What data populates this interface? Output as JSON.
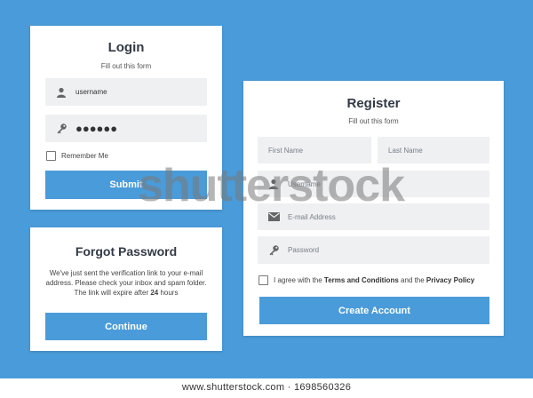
{
  "colors": {
    "background": "#4a9bd9",
    "button": "#4a9bd9",
    "field": "#eef0f2"
  },
  "login": {
    "title": "Login",
    "subtitle": "Fill out this form",
    "username_value": "username",
    "password_value": "●●●●●●",
    "remember_label": "Remember Me",
    "submit_label": "Submit",
    "icons": [
      "user-icon",
      "key-icon"
    ]
  },
  "forgot": {
    "title": "Forgot Password",
    "line1": "We've just sent the verification link to your e-mail",
    "line2": "address. Please check your inbox and spam folder.",
    "line3_prefix": "The link will expire after ",
    "line3_bold": "24",
    "line3_suffix": " hours",
    "continue_label": "Continue"
  },
  "register": {
    "title": "Register",
    "subtitle": "Fill out this form",
    "first_name_placeholder": "First Name",
    "last_name_placeholder": "Last Name",
    "username_placeholder": "Username",
    "email_placeholder": "E-mail Address",
    "password_placeholder": "Password",
    "agree_prefix": "I agree with the ",
    "terms_label": "Terms and Conditions",
    "agree_and": " and the ",
    "privacy_label": "Privacy Policy",
    "create_label": "Create Account",
    "icons": [
      "user-icon",
      "mail-icon",
      "key-icon"
    ]
  },
  "watermark": "shutterstock",
  "footer": "www.shutterstock.com · 1698560326"
}
